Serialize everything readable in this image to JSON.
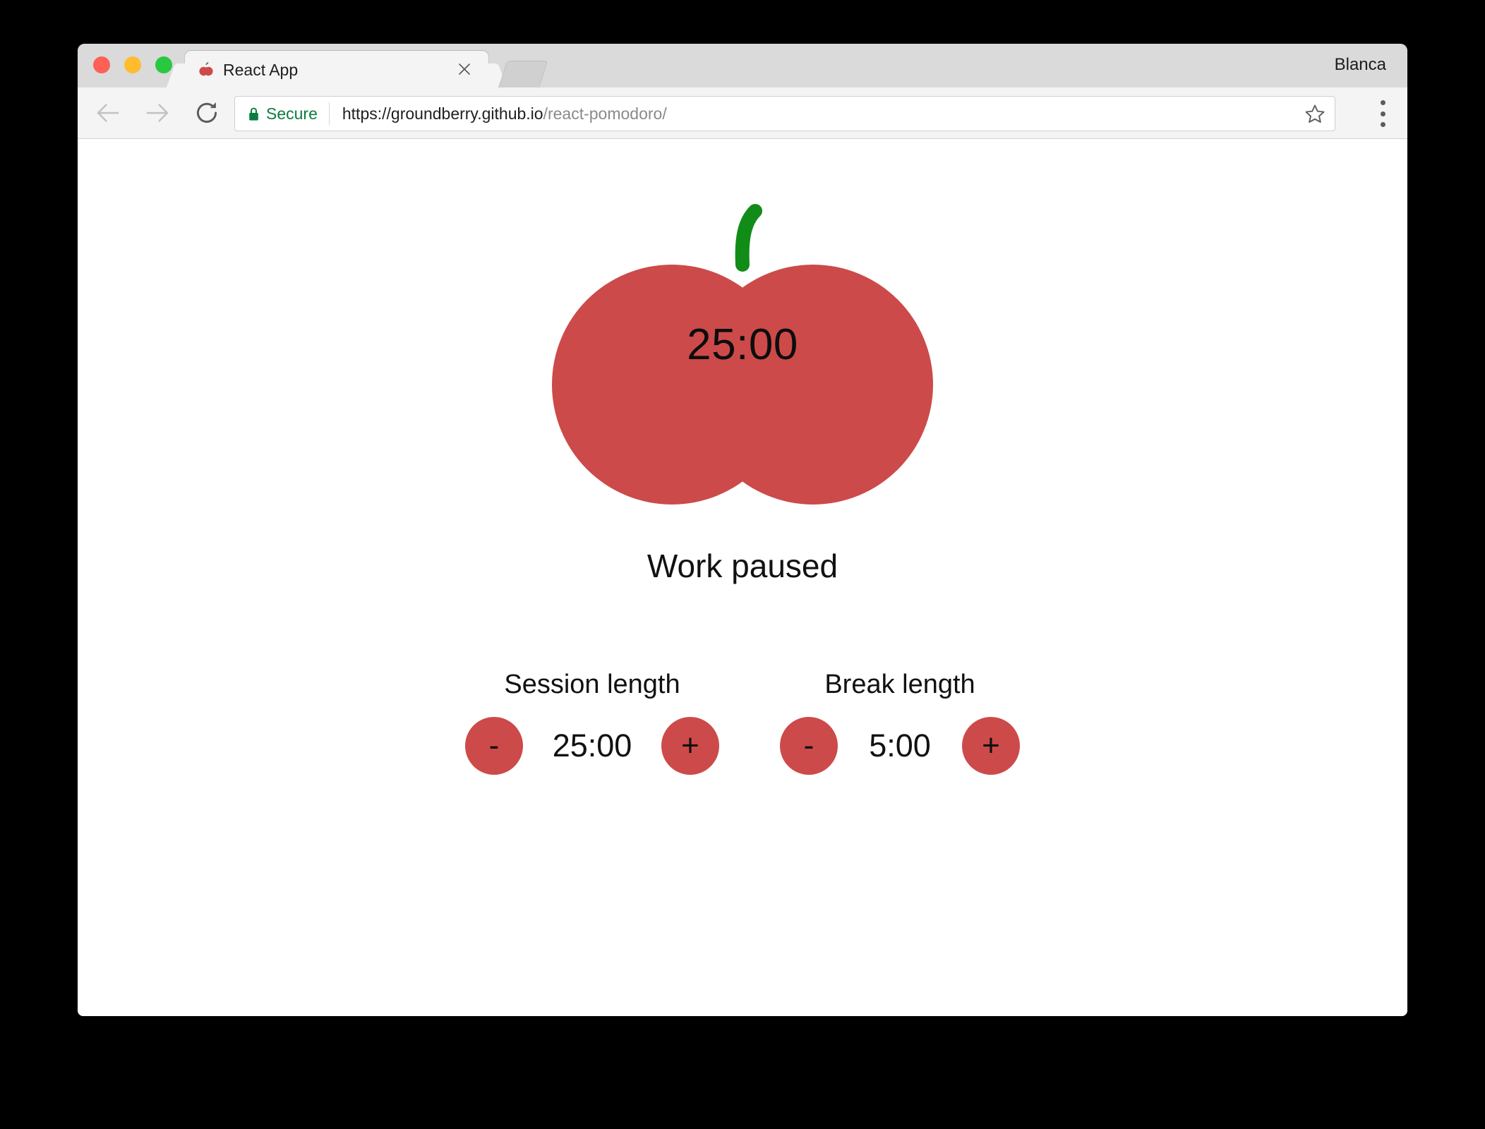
{
  "browser": {
    "profile_name": "Blanca",
    "tab": {
      "title": "React App",
      "favicon": "tomato-favicon",
      "close_icon": "close-icon"
    },
    "new_tab_icon": "new-tab-icon",
    "nav": {
      "back_icon": "arrow-left-icon",
      "forward_icon": "arrow-right-icon",
      "reload_icon": "reload-icon"
    },
    "omnibox": {
      "lock_icon": "lock-icon",
      "secure_label": "Secure",
      "url_prefix": "https://groundberry.github.io",
      "url_path": "/react-pomodoro/",
      "full_url": "https://groundberry.github.io/react-pomodoro/"
    },
    "bookmark_icon": "star-icon",
    "menu_icon": "three-dots-menu-icon"
  },
  "app": {
    "timer": {
      "value": "25:00",
      "status": "Work paused"
    },
    "settings": [
      {
        "label": "Session length",
        "value": "25:00",
        "decrement_label": "-",
        "increment_label": "+"
      },
      {
        "label": "Break length",
        "value": "5:00",
        "decrement_label": "-",
        "increment_label": "+"
      }
    ]
  },
  "colors": {
    "tomato_red": "#cd4a4a",
    "stem_green": "#128c18",
    "secure_green": "#0b7c3f",
    "page_background": "#ffffff",
    "desktop_background": "#000000",
    "traffic_close": "#ff6058",
    "traffic_minimize": "#ffbd2e",
    "traffic_maximize": "#28c840"
  }
}
